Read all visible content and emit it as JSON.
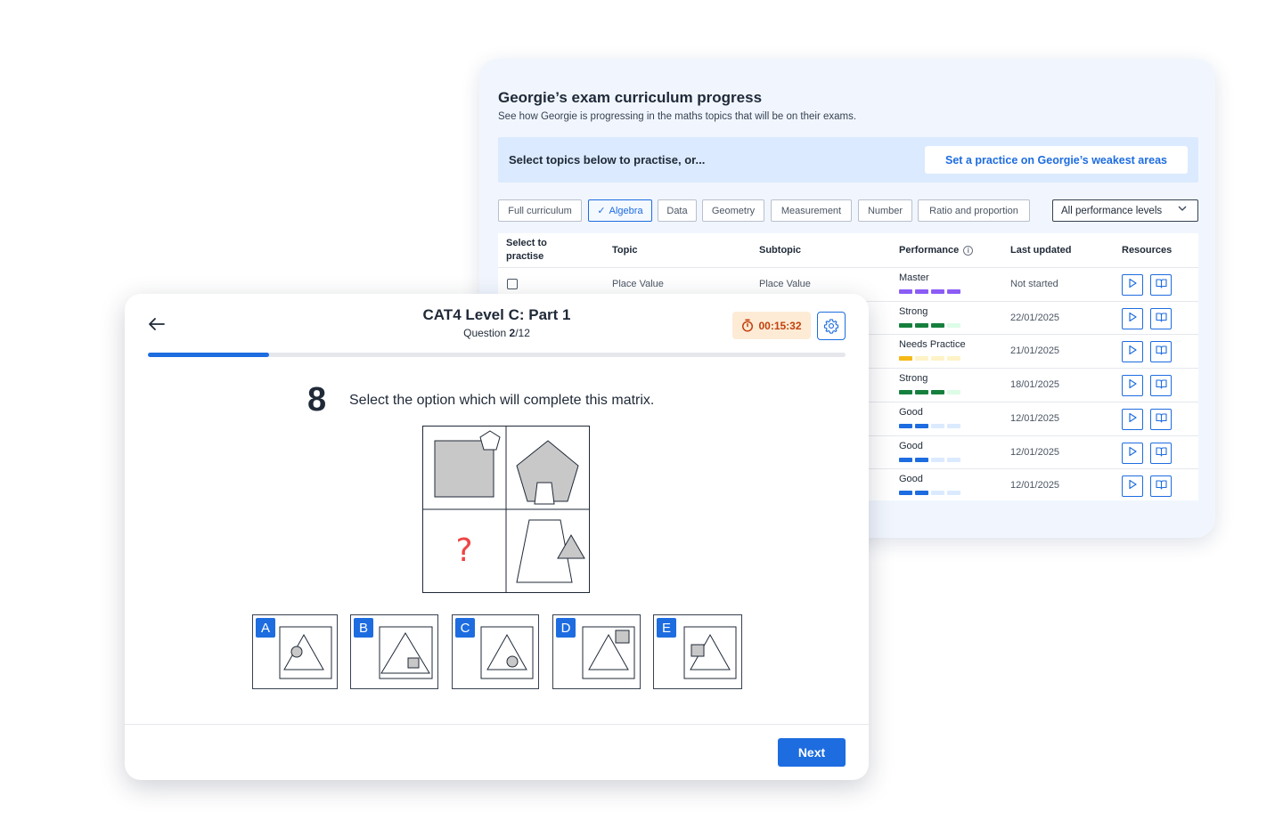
{
  "progress_panel": {
    "title": "Georgie’s exam curriculum progress",
    "subtitle": "See how Georgie is progressing in the maths topics that will be on their exams.",
    "banner_text": "Select topics below to practise, or...",
    "banner_button": "Set a practice on Georgie’s weakest areas",
    "filters": [
      {
        "label": "Full curriculum",
        "active": false
      },
      {
        "label": "Algebra",
        "active": true
      },
      {
        "label": "Data",
        "active": false
      },
      {
        "label": "Geometry",
        "active": false
      },
      {
        "label": "Measurement",
        "active": false
      },
      {
        "label": "Number",
        "active": false
      },
      {
        "label": "Ratio and proportion",
        "active": false
      }
    ],
    "performance_select": "All performance levels",
    "columns": {
      "select": "Select to practise",
      "topic": "Topic",
      "subtopic": "Subtopic",
      "performance": "Performance",
      "last_updated": "Last updated",
      "resources": "Resources"
    },
    "rows": [
      {
        "topic": "Place Value",
        "subtopic": "Place Value",
        "performance": "Master",
        "level": 4,
        "color": "#8b5cf6",
        "track": "#8b5cf6",
        "last_updated": "Not started"
      },
      {
        "topic": "",
        "subtopic": "",
        "performance": "Strong",
        "level": 3,
        "color": "#15803d",
        "track": "#dcfce7",
        "last_updated": "22/01/2025"
      },
      {
        "topic": "",
        "subtopic": "",
        "performance": "Needs Practice",
        "level": 1,
        "color": "#f5b816",
        "track": "#fef3c7",
        "last_updated": "21/01/2025"
      },
      {
        "topic": "",
        "subtopic": "",
        "performance": "Strong",
        "level": 3,
        "color": "#15803d",
        "track": "#dcfce7",
        "last_updated": "18/01/2025"
      },
      {
        "topic": "",
        "subtopic": "",
        "performance": "Good",
        "level": 2,
        "color": "#1d6ce0",
        "track": "#dbeafe",
        "last_updated": "12/01/2025"
      },
      {
        "topic": "",
        "subtopic": "",
        "performance": "Good",
        "level": 2,
        "color": "#1d6ce0",
        "track": "#dbeafe",
        "last_updated": "12/01/2025"
      },
      {
        "topic": "",
        "subtopic": "",
        "performance": "Good",
        "level": 2,
        "color": "#1d6ce0",
        "track": "#dbeafe",
        "last_updated": "12/01/2025"
      }
    ]
  },
  "test_panel": {
    "title": "CAT4 Level C: Part 1",
    "question_prefix": "Question ",
    "question_current": "2",
    "question_total": "/12",
    "timer": "00:15:32",
    "progress_fraction": 0.174,
    "question_number": "8",
    "question_text": "Select the option which will complete this matrix.",
    "missing_mark": "?",
    "options": [
      "A",
      "B",
      "C",
      "D",
      "E"
    ],
    "next_button": "Next",
    "icons": {
      "back": "arrow-left-icon",
      "timer": "stopwatch-icon",
      "settings": "gear-icon"
    }
  },
  "colors": {
    "accent": "#1d6ce0",
    "timer_bg": "#fdebd6",
    "timer_text": "#c2410c",
    "question_mark": "#ef4444"
  }
}
